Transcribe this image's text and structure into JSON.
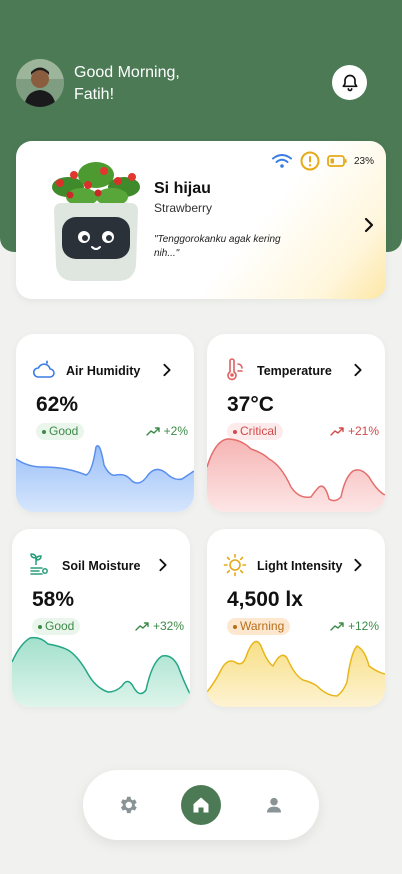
{
  "header": {
    "greeting": "Good Morning,",
    "user_name": "Fatih!",
    "bell_icon": "bell-icon"
  },
  "plant": {
    "name": "Si hijau",
    "species": "Strawberry",
    "quote": "\"Tenggorokanku agak kering nih...\"",
    "battery_percent": "23%",
    "status_icons": [
      "wifi-icon",
      "alert-icon",
      "battery-icon"
    ]
  },
  "metrics": [
    {
      "title": "Air Humidity",
      "value": "62%",
      "status": "Good",
      "trend": "+2%",
      "icon": "cloud-humidity-icon",
      "color": "#6a9ef0"
    },
    {
      "title": "Temperature",
      "value": "37°C",
      "status": "Critical",
      "trend": "+21%",
      "icon": "thermometer-icon",
      "color": "#ef7b7b"
    },
    {
      "title": "Soil Moisture",
      "value": "58%",
      "status": "Good",
      "trend": "+32%",
      "icon": "sprout-icon",
      "color": "#2fb08a"
    },
    {
      "title": "Light Intensity",
      "value": "4,500 lx",
      "status": "Warning",
      "trend": "+12%",
      "icon": "sun-icon",
      "color": "#f2c21c"
    }
  ],
  "nav": {
    "items": [
      "settings-icon",
      "home-icon",
      "user-icon"
    ],
    "active": "home-icon"
  },
  "colors": {
    "brand_green": "#4b7a55",
    "background": "#f1f2ef"
  }
}
